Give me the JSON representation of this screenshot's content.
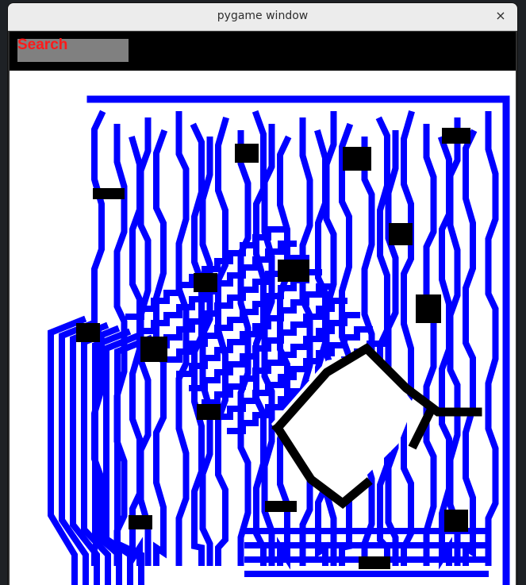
{
  "window": {
    "title": "pygame window",
    "close_glyph": "×"
  },
  "toolbar": {
    "search_label": "Search"
  },
  "maze": {
    "wall_color": "#0000ff",
    "path_color": "#000000",
    "background_color": "#ffffff"
  },
  "colors": {
    "toolbar_bg": "#000000",
    "search_box": "#808080",
    "search_text": "#ff1a1a"
  }
}
